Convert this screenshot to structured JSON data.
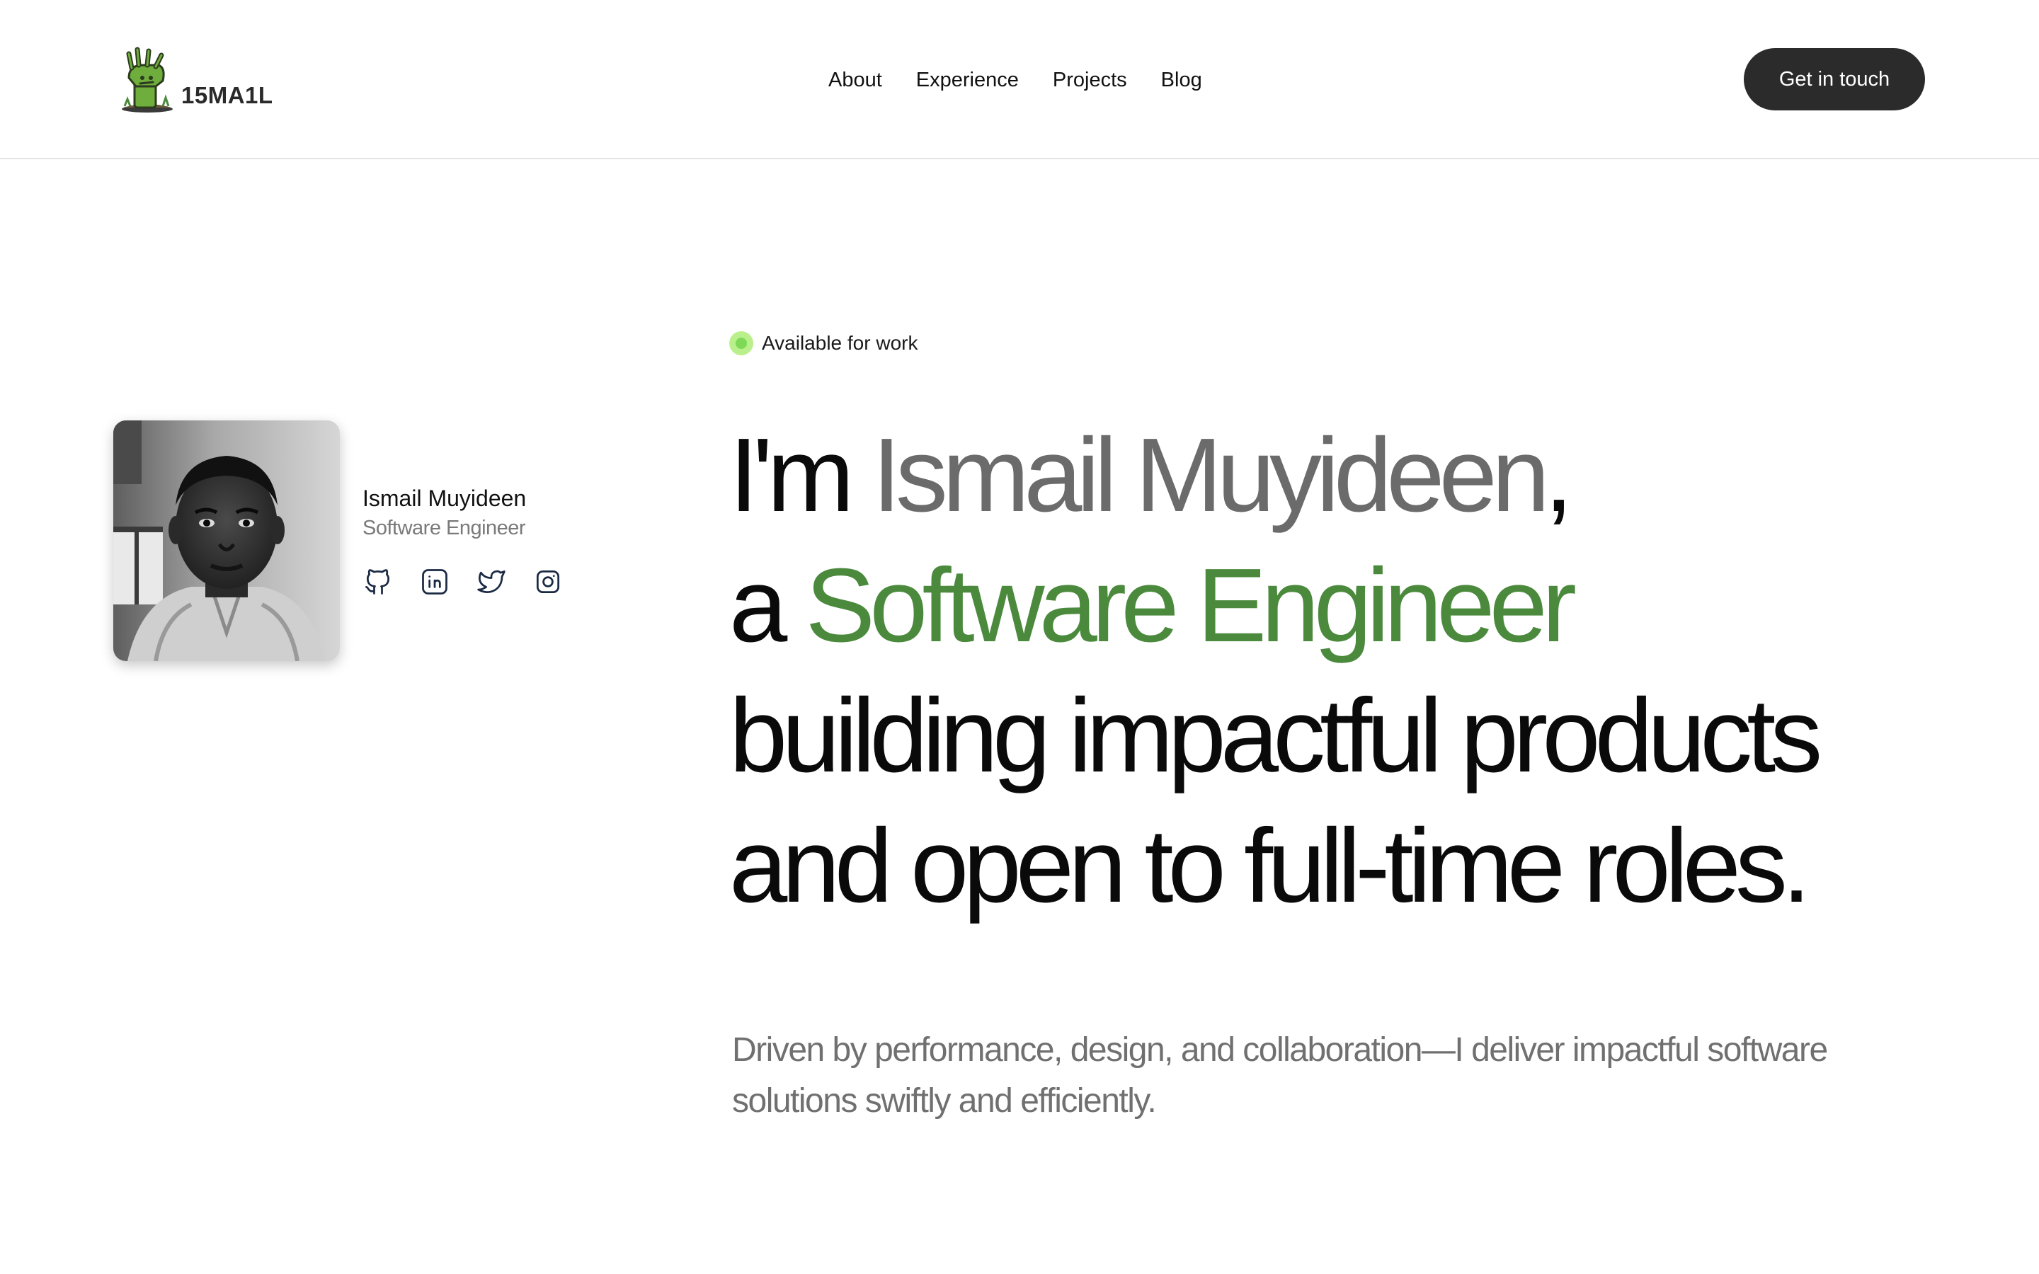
{
  "brand": {
    "logo_text": "15MA1L",
    "accent": "#4b8a3d"
  },
  "nav": {
    "items": [
      {
        "label": "About"
      },
      {
        "label": "Experience"
      },
      {
        "label": "Projects"
      },
      {
        "label": "Blog"
      }
    ],
    "cta_label": "Get in touch"
  },
  "profile": {
    "name": "Ismail Muyideen",
    "role": "Software Engineer",
    "socials": [
      "github-icon",
      "linkedin-icon",
      "twitter-icon",
      "instagram-icon"
    ]
  },
  "hero": {
    "status": "Available for work",
    "status_color": "#7ed957",
    "line1_prefix": "I'm",
    "line1_name": "Ismail Muyideen",
    "line1_suffix": ",",
    "line2_prefix": "a",
    "line2_role": "Software Engineer",
    "line3": "building impactful products",
    "line4": "and open to full-time roles.",
    "description": "Driven by performance, design, and collaboration—I deliver impactful software solutions swiftly and efficiently."
  }
}
